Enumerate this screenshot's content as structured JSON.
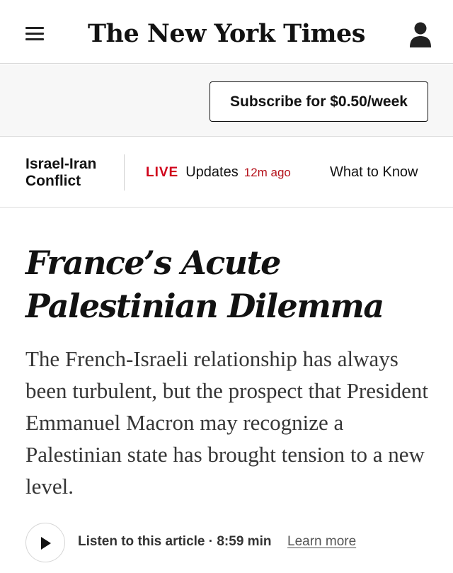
{
  "header": {
    "logo_text": "The New York Times",
    "menu_icon": "hamburger-menu-icon",
    "account_icon": "user-account-icon"
  },
  "subscribe": {
    "button_label": "Subscribe for $0.50/week"
  },
  "live_strip": {
    "topic": "Israel-Iran Conflict",
    "live_tag": "LIVE",
    "updates_label": "Updates",
    "updated_time": "12m ago",
    "what_to_know": "What to Know"
  },
  "article": {
    "headline": "France’s Acute Palestinian Dilemma",
    "summary": "The French-Israeli relationship has always been turbulent, but the prospect that President Emmanuel Macron may recognize a Palestinian state has brought tension to a new level."
  },
  "audio": {
    "play_icon": "play-icon",
    "listen_label": "Listen to this article · 8:59 min",
    "learn_more": "Learn more"
  },
  "colors": {
    "live_red": "#d0021b",
    "text_primary": "#121212",
    "band_gray": "#f7f7f7"
  }
}
